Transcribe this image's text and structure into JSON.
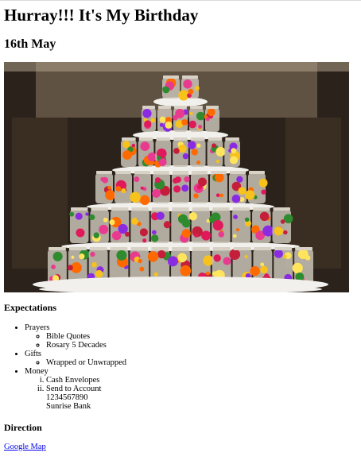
{
  "header": {
    "title": "Hurray!!! It's My Birthday",
    "date": "16th May"
  },
  "photo": {
    "icon": "flower-jar-tower-photo",
    "colors": {
      "backdrop": "#2a221b",
      "wall": "#8b7a63",
      "plinth": "#f2f0ec",
      "jar_glass": "#c9c2b6"
    },
    "flower_colors": [
      "#e0195a",
      "#f7c21b",
      "#8a2be2",
      "#ff6a00",
      "#e83b8f",
      "#2e8b2e",
      "#c41e3a",
      "#ffe45c"
    ]
  },
  "expectations": {
    "heading": "Expectations",
    "items": [
      {
        "label": "Prayers",
        "children": [
          "Bible Quotes",
          "Rosary 5 Decades"
        ]
      },
      {
        "label": "Gifts",
        "children": [
          "Wrapped or Unwrapped"
        ]
      },
      {
        "label": "Money",
        "ordered": true,
        "children": [
          "Cash Envelopes",
          "Send to Account"
        ],
        "account": {
          "number": "1234567890",
          "bank": "Sunrise Bank"
        }
      }
    ]
  },
  "direction": {
    "heading": "Direction",
    "link_label": "Google Map",
    "link_color": "#0000ee"
  }
}
